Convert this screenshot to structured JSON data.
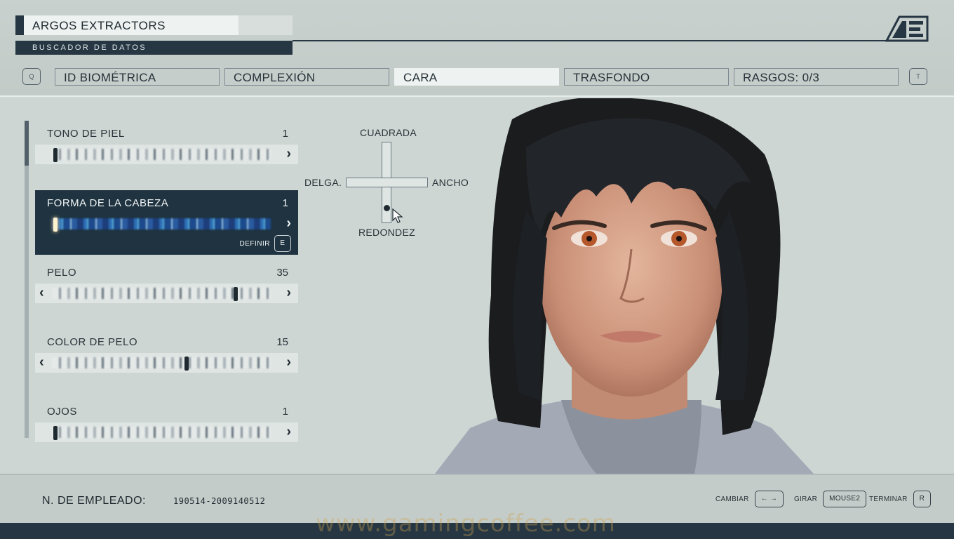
{
  "header": {
    "title": "ARGOS EXTRACTORS",
    "subtitle": "BUSCADOR DE DATOS",
    "logo": "AE",
    "prev_key": "Q",
    "next_key": "T"
  },
  "tabs": [
    {
      "label": "ID BIOMÉTRICA",
      "active": false
    },
    {
      "label": "COMPLEXIÓN",
      "active": false
    },
    {
      "label": "CARA",
      "active": true
    },
    {
      "label": "TRASFONDO",
      "active": false
    },
    {
      "label": "RASGOS: 0/3",
      "active": false
    }
  ],
  "sliders": [
    {
      "label": "TONO DE PIEL",
      "value": "1",
      "level": 0.0
    },
    {
      "label": "FORMA DE LA CABEZA",
      "value": "1",
      "level": 0.0,
      "selected": true
    },
    {
      "label": "PELO",
      "value": "35",
      "level": 0.83
    },
    {
      "label": "COLOR DE PELO",
      "value": "15",
      "level": 0.6
    },
    {
      "label": "OJOS",
      "value": "1",
      "level": 0.0
    }
  ],
  "define": {
    "label": "DEFINIR",
    "key": "E"
  },
  "shape_pad": {
    "top": "CUADRADA",
    "left": "DELGA.",
    "right": "ANCHO",
    "bottom": "REDONDEZ"
  },
  "footer": {
    "employee_label": "N. DE EMPLEADO:",
    "employee_value": "190514-2009140512",
    "controls": [
      {
        "label": "CAMBIAR",
        "key": "← →"
      },
      {
        "label": "GIRAR",
        "key": "MOUSE2"
      },
      {
        "label": "TERMINAR",
        "key": "R"
      }
    ]
  },
  "watermark": "www.gamingcoffee.com",
  "colors": {
    "accent_dark": "#263743",
    "selected_row": "#1f3340",
    "background": "#cdd6d3"
  }
}
